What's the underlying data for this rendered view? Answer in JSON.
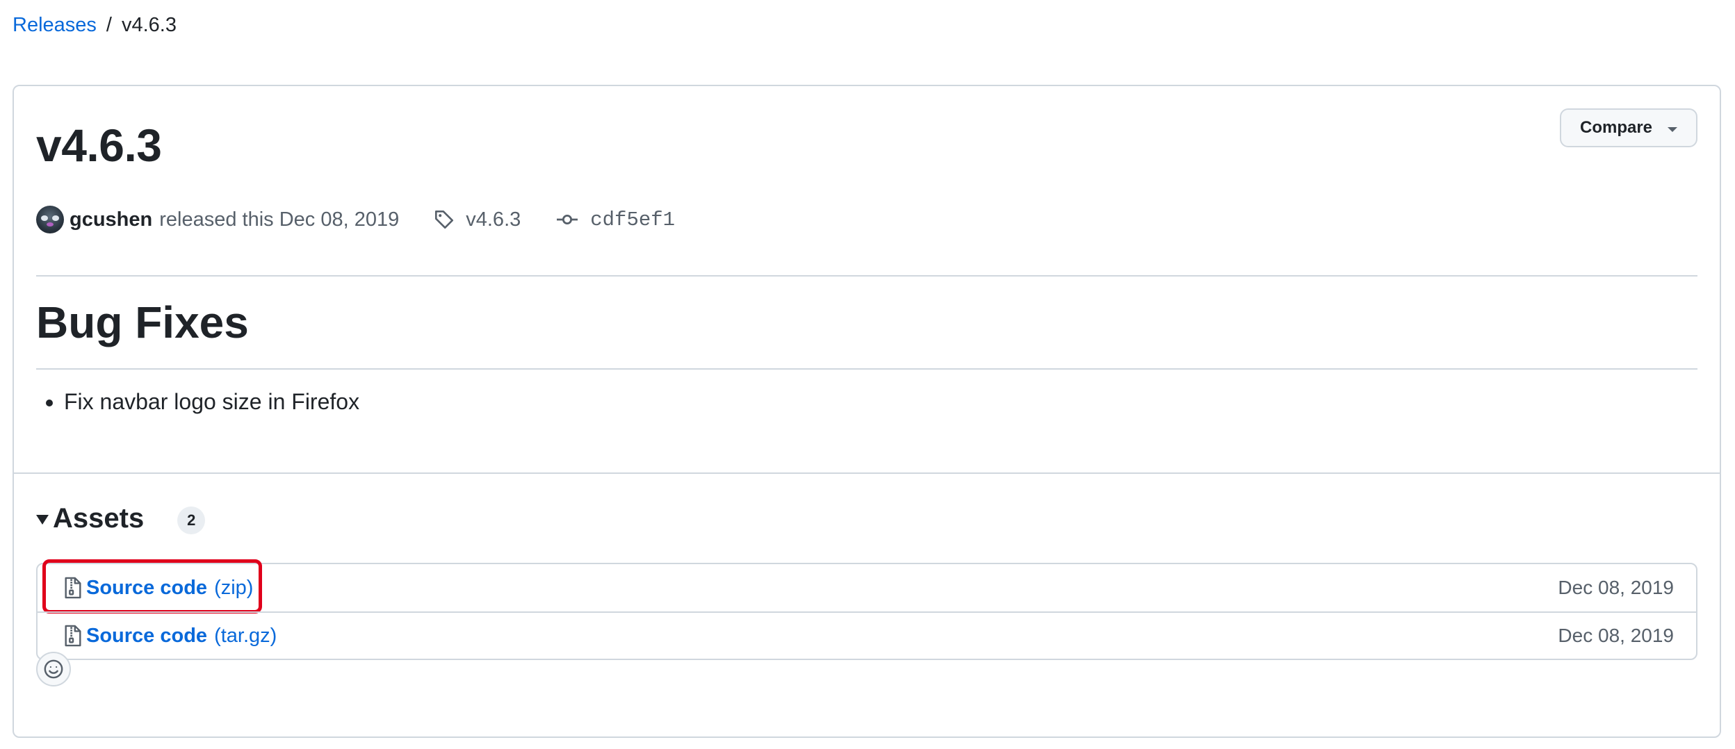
{
  "breadcrumb": {
    "parent": "Releases",
    "separator": "/",
    "current": "v4.6.3"
  },
  "release": {
    "title": "v4.6.3",
    "compare_label": "Compare",
    "author": "gcushen",
    "released_text": "released this Dec 08, 2019",
    "tag": "v4.6.3",
    "commit": "cdf5ef1"
  },
  "notes": {
    "heading": "Bug Fixes",
    "items": [
      "Fix navbar logo size in Firefox"
    ]
  },
  "assets": {
    "title": "Assets",
    "count": "2",
    "items": [
      {
        "name": "Source code",
        "ext": "(zip)",
        "date": "Dec 08, 2019"
      },
      {
        "name": "Source code",
        "ext": "(tar.gz)",
        "date": "Dec 08, 2019"
      }
    ]
  },
  "colors": {
    "link": "#0969da",
    "highlight": "#e0001b",
    "border": "#d0d7de"
  }
}
